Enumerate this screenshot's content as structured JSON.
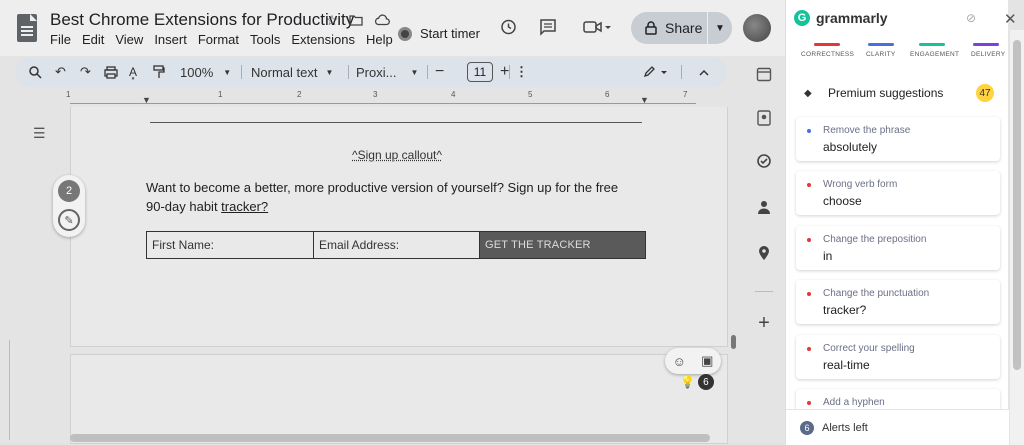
{
  "doc": {
    "title": "Best Chrome Extensions for Productivity",
    "menu": [
      "File",
      "Edit",
      "View",
      "Insert",
      "Format",
      "Tools",
      "Extensions",
      "Help"
    ],
    "start_timer": "Start timer",
    "share_label": "Share"
  },
  "toolbar": {
    "zoom": "100%",
    "style": "Normal text",
    "font": "Proxi...",
    "font_size": "11"
  },
  "ruler": {
    "labels": [
      "1",
      "1",
      "2",
      "3",
      "4",
      "5",
      "6",
      "7"
    ]
  },
  "content": {
    "callout": "^Sign up callout^",
    "paragraph_line1": "Want to become a better, more productive version of yourself? Sign up for the free",
    "paragraph_line2": "90-day habit ",
    "paragraph_link": "tracker?",
    "form": {
      "first_name": "First Name:",
      "email": "Email Address:",
      "cta": "GET THE TRACKER"
    }
  },
  "bubble": {
    "count": "2"
  },
  "float": {
    "badge": "6"
  },
  "grammarly": {
    "brand": "grammarly",
    "categories": [
      {
        "label": "CORRECTNESS",
        "color": "#e5343a"
      },
      {
        "label": "CLARITY",
        "color": "#4a6ee0"
      },
      {
        "label": "ENGAGEMENT",
        "color": "#15c39a"
      },
      {
        "label": "DELIVERY",
        "color": "#7b3fe4"
      }
    ],
    "premium_label": "Premium suggestions",
    "premium_count": "47",
    "suggestions": [
      {
        "title": "Remove the phrase",
        "value": "absolutely",
        "color": "#4a6ee0"
      },
      {
        "title": "Wrong verb form",
        "value": "choose",
        "color": "#e5343a"
      },
      {
        "title": "Change the preposition",
        "value": "in",
        "color": "#e5343a"
      },
      {
        "title": "Change the punctuation",
        "value": "tracker?",
        "color": "#e5343a"
      },
      {
        "title": "Correct your spelling",
        "value": "real-time",
        "color": "#e5343a"
      },
      {
        "title": "Add a hyphen",
        "value": "",
        "color": "#e5343a"
      }
    ],
    "alerts_count": "6",
    "alerts_label": "Alerts left"
  }
}
